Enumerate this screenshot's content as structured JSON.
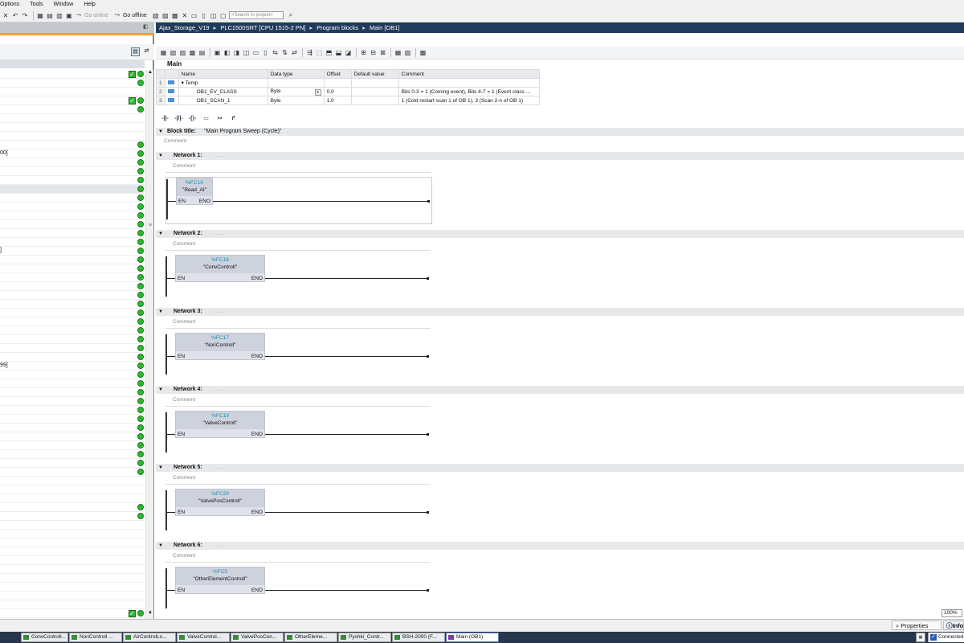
{
  "menu": [
    "Options",
    "Tools",
    "Window",
    "Help"
  ],
  "toolbar": {
    "go_online": "Go online",
    "go_offline": "Go offline",
    "search_placeholder": "<Search in project>"
  },
  "breadcrumb": [
    "Ajax_Storage_V19",
    "PLC1500SRT [CPU 1515-2 PN]",
    "Program blocks",
    "Main [OB1]"
  ],
  "left_pane": {
    "partial_labels": [
      {
        "text": "00]",
        "row": 9
      },
      {
        "text": "]",
        "row": 20
      },
      {
        "text": "99]",
        "row": 33
      }
    ]
  },
  "interface": {
    "title": "Main",
    "columns": [
      "Name",
      "Data type",
      "Offset",
      "Default value",
      "Comment"
    ],
    "rows": [
      {
        "num": "1",
        "name": "Temp",
        "type": "",
        "offset": "",
        "default": "",
        "comment": "",
        "section": true
      },
      {
        "num": "2",
        "name": "OB1_EV_CLASS",
        "type": "Byte",
        "offset": "0.0",
        "default": "",
        "comment": "Bits 0-3 = 1 (Coming event), Bits 4-7 = 1 (Event class ..."
      },
      {
        "num": "3",
        "name": "OB1_SCAN_1",
        "type": "Byte",
        "offset": "1.0",
        "default": "",
        "comment": "1 (Cold restart scan 1 of OB 1), 3 (Scan 2-n of OB 1)"
      }
    ]
  },
  "block": {
    "title_label": "Block title:",
    "title_value": "\"Main Program Sweep (Cycle)\"",
    "comment": "Comment"
  },
  "networks": [
    {
      "label": "Network 1:",
      "comment": "Comment",
      "fc": "%FC10",
      "name": "\"Read_AI\"",
      "en": "EN",
      "eno": "ENO"
    },
    {
      "label": "Network 2:",
      "comment": "Comment",
      "fc": "%FC18",
      "name": "\"ConvControll\"",
      "en": "EN",
      "eno": "ENO"
    },
    {
      "label": "Network 3:",
      "comment": "Comment",
      "fc": "%FC17",
      "name": "\"NoriControll\"",
      "en": "EN",
      "eno": "ENO"
    },
    {
      "label": "Network 4:",
      "comment": "Comment",
      "fc": "%FC19",
      "name": "\"ValveControll\"",
      "en": "EN",
      "eno": "ENO"
    },
    {
      "label": "Network 5:",
      "comment": "Comment",
      "fc": "%FC20",
      "name": "\"ValvePosControll\"",
      "en": "EN",
      "eno": "ENO"
    },
    {
      "label": "Network 6:",
      "comment": "Comment",
      "fc": "%FC5",
      "name": "\"OtherElementControll\"",
      "en": "EN",
      "eno": "ENO"
    }
  ],
  "bottom": {
    "zoom": "100%",
    "properties": "Properties",
    "info": "Info",
    "connected": "Connected"
  },
  "taskbar": [
    "ConvControll...",
    "NoriControll ...",
    "AirControlLo...",
    "ValveControl...",
    "ValvePosCon...",
    "OtherEleme...",
    "Pyshki_Contr...",
    "BSH-2000 (F...",
    "Main (OB1)"
  ],
  "colors": {
    "status_green": "#2eb82e",
    "breadcrumb_bg": "#1f3a5a",
    "fc_number": "#1a8fb5"
  }
}
